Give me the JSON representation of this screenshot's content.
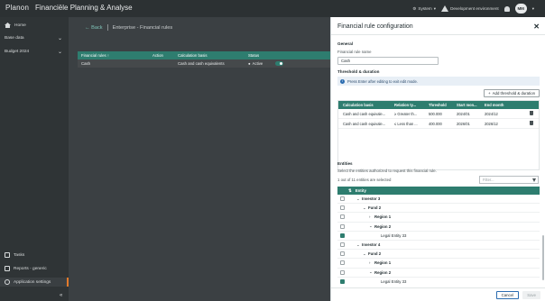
{
  "topbar": {
    "logo": "Planon",
    "app_title": "Financiële Planning & Analyse",
    "system_label": "System",
    "environment_label": "Development environment",
    "avatar_initials": "MM"
  },
  "sidebar": {
    "items": [
      {
        "label": "Home"
      },
      {
        "label": "Base data"
      },
      {
        "label": "Budget 2024"
      }
    ],
    "bottom_items": [
      {
        "label": "Tasks"
      },
      {
        "label": "Reports - generic"
      },
      {
        "label": "Application settings"
      }
    ],
    "collapse": "«"
  },
  "main": {
    "back_label": "Back",
    "page_title": "Enterprise - Financial rules",
    "table": {
      "headers": [
        "Financial rules",
        "Action",
        "Calculation basis",
        "Status"
      ],
      "rows": [
        {
          "rule": "Cash",
          "action": "",
          "basis": "Cash and cash equivalents",
          "status": "Active"
        }
      ]
    }
  },
  "panel": {
    "title": "Financial rule configuration",
    "close": "✕",
    "general": {
      "heading": "General",
      "name_label": "Financial rule name",
      "name_value": "Cash"
    },
    "threshold": {
      "heading": "Threshold & duration",
      "info": "Press Enter after editing to exit edit mode.",
      "add_button": "Add threshold & duration",
      "headers": [
        "Calculation basis",
        "Relation ty...",
        "Threshold",
        "Start mon...",
        "End month"
      ],
      "rows": [
        {
          "basis": "Cash and cash equivale...",
          "relation": "≥ Greater th...",
          "threshold": "500.000",
          "start": "2024/01",
          "end": "2024/12"
        },
        {
          "basis": "Cash and cash equivale...",
          "relation": "≤ Less than ...",
          "threshold": "400.000",
          "start": "2026/01",
          "end": "2026/12"
        }
      ]
    },
    "entities": {
      "heading": "Entities",
      "description": "Select the entities authorized to request this financial rule.",
      "selected_count": "1 out of 11 entities are selected",
      "filter_placeholder": "Filter...",
      "column": "Entity",
      "rows": [
        {
          "label": "Investor 3",
          "level": 1,
          "caret": "⌄",
          "checked": false
        },
        {
          "label": "Fund 2",
          "level": 2,
          "caret": "⌄",
          "checked": false
        },
        {
          "label": "Region 1",
          "level": 3,
          "caret": "›",
          "checked": false
        },
        {
          "label": "Region 2",
          "level": 3,
          "caret": "⌄",
          "checked": false
        },
        {
          "label": "Legal Entity 33",
          "level": 4,
          "caret": "",
          "checked": true
        },
        {
          "label": "Investor 4",
          "level": 1,
          "caret": "⌄",
          "checked": false
        },
        {
          "label": "Fund 2",
          "level": 2,
          "caret": "⌄",
          "checked": false
        },
        {
          "label": "Region 1",
          "level": 3,
          "caret": "›",
          "checked": false
        },
        {
          "label": "Region 2",
          "level": 3,
          "caret": "⌄",
          "checked": false
        },
        {
          "label": "Legal Entity 33",
          "level": 4,
          "caret": "",
          "checked": true
        }
      ]
    },
    "footer": {
      "cancel": "Cancel",
      "save": "Save"
    }
  }
}
